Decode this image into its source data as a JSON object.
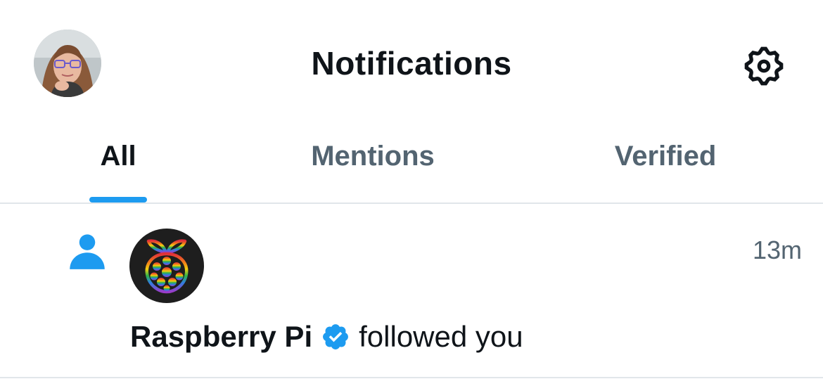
{
  "header": {
    "title": "Notifications",
    "profile_avatar_icon": "user-profile-photo",
    "settings_icon": "gear-icon"
  },
  "tabs": [
    {
      "label": "All",
      "active": true
    },
    {
      "label": "Mentions",
      "active": false
    },
    {
      "label": "Verified",
      "active": false
    }
  ],
  "notifications": [
    {
      "type_icon": "person-icon",
      "account_name": "Raspberry Pi",
      "verified": true,
      "action": "followed you",
      "time": "13m"
    }
  ],
  "colors": {
    "accent": "#1d9bf0",
    "text_primary": "#0f1419",
    "text_secondary": "#536471",
    "divider": "#e1e6ea"
  }
}
